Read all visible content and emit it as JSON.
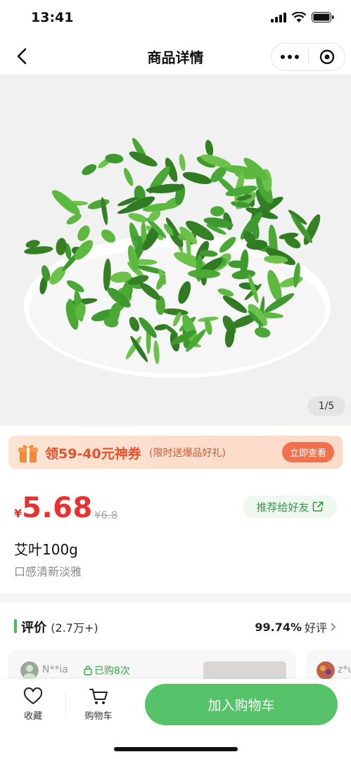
{
  "status_bar": {
    "time": "13:41"
  },
  "nav": {
    "title": "商品详情"
  },
  "gallery": {
    "counter": "1/5"
  },
  "promo": {
    "main": "领59-40元神券",
    "sub": "(限时送爆品好礼)",
    "button": "立即查看"
  },
  "product": {
    "currency": "¥",
    "price": "5.68",
    "original_price": "¥6.8",
    "share_label": "推荐给好友",
    "name": "艾叶100g",
    "description": "口感清新淡雅"
  },
  "reviews": {
    "title": "评价",
    "count": "(2.7万+)",
    "rate_value": "99.74%",
    "rate_label": "好评",
    "items": [
      {
        "user": "N**ia",
        "badge": "已购8次"
      },
      {
        "user": "z*u"
      }
    ]
  },
  "bottom_bar": {
    "favorite": "收藏",
    "cart": "购物车",
    "add_to_cart": "加入购物车"
  },
  "colors": {
    "accent": "#56c26a",
    "price": "#ea2f2f",
    "promo": "#e8512a"
  }
}
